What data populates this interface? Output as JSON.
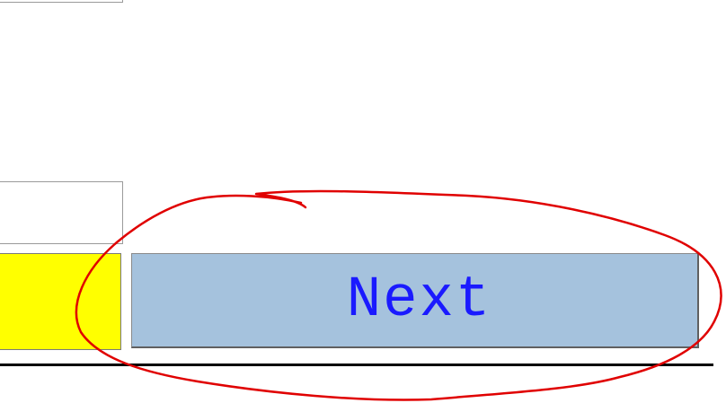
{
  "next_button": {
    "label": "Next"
  },
  "colors": {
    "yellow_panel": "#ffff00",
    "button_fill": "#a5c2dd",
    "button_text": "#1a1aff",
    "annotation_stroke": "#e00000",
    "rule": "#000000"
  },
  "annotation": {
    "shape": "hand-drawn-ellipse",
    "target": "next-button"
  }
}
